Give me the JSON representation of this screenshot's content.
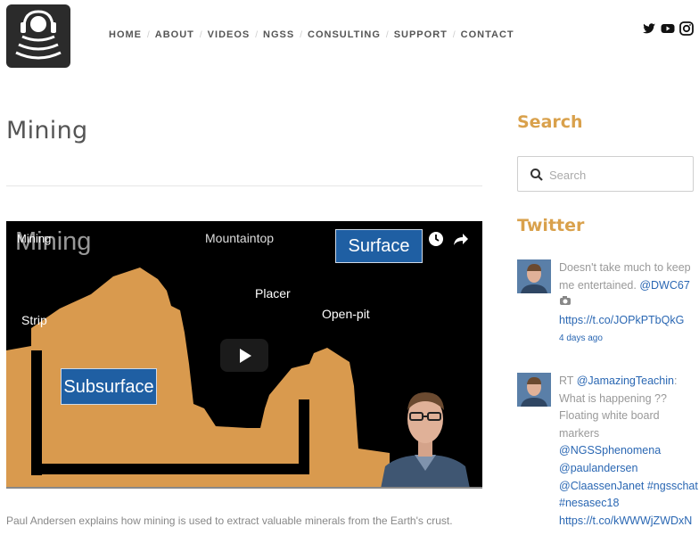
{
  "nav": {
    "items": [
      "HOME",
      "ABOUT",
      "VIDEOS",
      "NGSS",
      "CONSULTING",
      "SUPPORT",
      "CONTACT"
    ]
  },
  "social": [
    "twitter-icon",
    "youtube-icon",
    "instagram-icon"
  ],
  "main": {
    "title": "Mining",
    "caption": "Paul Andersen explains how mining is used to extract valuable minerals from the Earth's crust."
  },
  "video": {
    "title": "Mining",
    "big_title": "Mining",
    "labels": {
      "mountaintop": "Mountaintop",
      "surface": "Surface",
      "placer": "Placer",
      "open_pit": "Open-pit",
      "strip": "Strip",
      "subsurface": "Subsurface"
    }
  },
  "sidebar": {
    "search_heading": "Search",
    "search_placeholder": "Search",
    "twitter_heading": "Twitter",
    "tweets": [
      {
        "text": "Doesn't take much to keep me entertained. ",
        "mention": "@DWC67",
        "link": "https://t.co/JOPkPTbQkG",
        "time": "4 days ago"
      },
      {
        "prefix": "RT ",
        "mention": "@JamazingTeachin",
        "text": ": What is happening ?? Floating white board markers ",
        "tags": "@NGSSphenomena @paulandersen @ClaassenJanet #ngsschat #nesasec18",
        "link": "https://t.co/kWWWjZWDxN"
      }
    ]
  },
  "colors": {
    "accent": "#d9a14c",
    "link": "#2a67b3",
    "orange_terrain": "#d99a4e",
    "box_blue": "#1f5fa3"
  }
}
